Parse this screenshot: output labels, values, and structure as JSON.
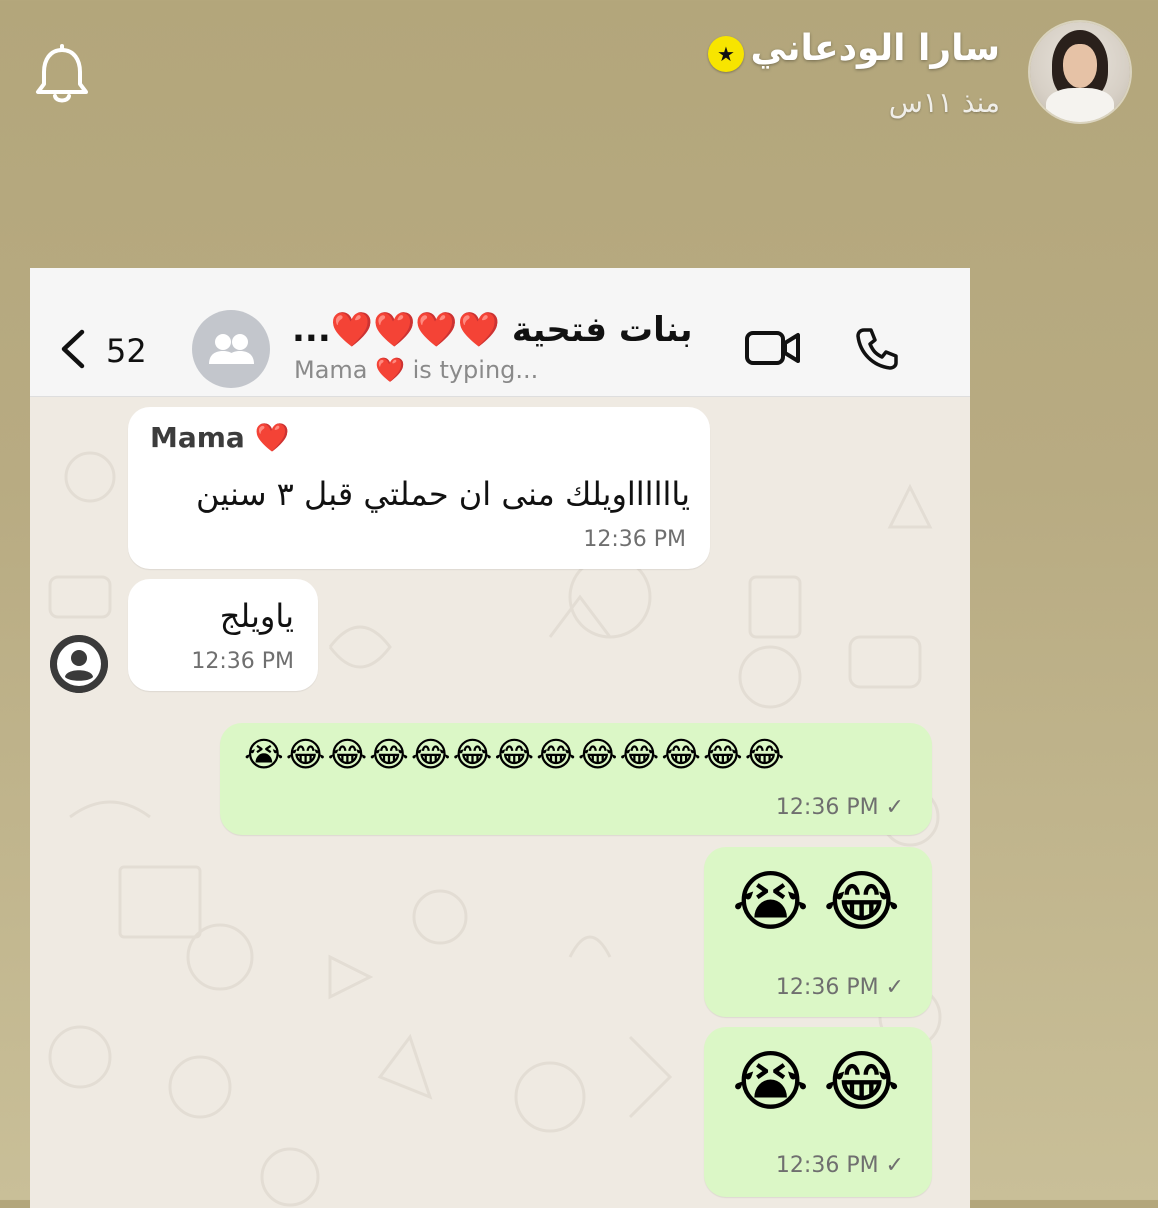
{
  "story": {
    "username": "سارا الودعاني",
    "time_ago": "منذ ١١س"
  },
  "chat": {
    "unread_count": "52",
    "group_name": "بنات فتحية ❤️❤️❤️❤️...",
    "typing_status": "Mama ❤️ is typing...",
    "messages": [
      {
        "direction": "in",
        "sender": "Mama ❤️",
        "text": "يااااااويلك منى ان حملتي قبل ٣ سنين",
        "time": "12:36 PM"
      },
      {
        "direction": "in",
        "text": "ياويلج",
        "time": "12:36 PM"
      },
      {
        "direction": "out",
        "text": "😭😂😂😂😂😂😂😂😂😂😂😂😂",
        "time": "12:36 PM ✓"
      },
      {
        "direction": "out",
        "text": "😭😂",
        "time": "12:36 PM ✓"
      },
      {
        "direction": "out",
        "text": "😭😂",
        "time": "12:36 PM ✓"
      }
    ]
  },
  "icons": {
    "story_bell": "bell-icon",
    "back": "chevron-left-icon",
    "group_avatar": "group-icon",
    "video": "video-camera-icon",
    "phone": "phone-icon",
    "person": "person-icon"
  },
  "colors": {
    "story_background": "#b8ab82",
    "bubble_incoming": "#ffffff",
    "bubble_outgoing": "#dbf7c6",
    "chat_wallpaper": "#efeae2",
    "star_badge": "#f7e500"
  }
}
